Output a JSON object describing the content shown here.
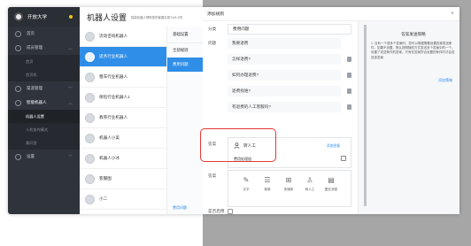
{
  "sidebar": {
    "brand": "开放大学",
    "items": [
      {
        "label": "首页",
        "type": "item"
      },
      {
        "label": "成员管理",
        "type": "item",
        "chev": "︿"
      },
      {
        "label": "首页",
        "type": "sub"
      },
      {
        "label": "首页机",
        "type": "sub"
      },
      {
        "label": "渠道管理",
        "type": "item",
        "chev": "﹀"
      },
      {
        "label": "智能机器人",
        "type": "item",
        "chev": "︿",
        "active": true
      },
      {
        "label": "机器人设置",
        "type": "sub",
        "active": true
      },
      {
        "label": "人机协作模式",
        "type": "sub"
      },
      {
        "label": "素问答",
        "type": "sub"
      },
      {
        "label": "设置",
        "type": "item",
        "chev": "﹀"
      }
    ]
  },
  "middle": {
    "title": "机器人设置",
    "hint": "智能机器人帮助您的客服实现7x24小时",
    "bots": [
      {
        "name": "流动咨询机器人"
      },
      {
        "name": "适务行业机器人",
        "active": true
      },
      {
        "name": "租车行业机器人"
      },
      {
        "name": "保险行业机器人1"
      },
      {
        "name": "教育行业机器人"
      },
      {
        "name": "机器人小美"
      },
      {
        "name": "机器人小冰"
      },
      {
        "name": "客服图"
      },
      {
        "name": "小二"
      }
    ],
    "config_tabs": [
      "基础设置",
      "全部规则",
      "费用问题"
    ],
    "config_footer": "费用问题"
  },
  "modal": {
    "title": "添加规则",
    "close": "×",
    "labels": {
      "category": "分类",
      "question": "问题",
      "answer": "答案",
      "answer2": "答案",
      "enable": "是否启用"
    },
    "category_value": "费用问题",
    "questions": [
      "我要退费",
      "怎样退费?",
      "如何办理退费?",
      "退费找谁?",
      "有退费的人工客服吗?"
    ],
    "answer": {
      "transfer_label": "转人工",
      "link": "添加答案",
      "text": "费用处理组"
    },
    "tools": [
      {
        "icon": "✎",
        "label": "文字"
      },
      {
        "icon": "☰",
        "label": "菜单"
      },
      {
        "icon": "⊞",
        "label": "多媒体"
      },
      {
        "icon": "♙",
        "label": "转人工"
      },
      {
        "icon": "▤",
        "label": "图文消息"
      }
    ],
    "side": {
      "title": "答案发送策略",
      "text": "1. 当有一个或多个答案时，您可以根据需要设置答案发送条件，如果不设置，默认按照随机方式发送多个答案中的一个。设置了发送条件的答案，只有在答案符合设置的条件时才会发送该答案",
      "link": "添加策略"
    }
  }
}
